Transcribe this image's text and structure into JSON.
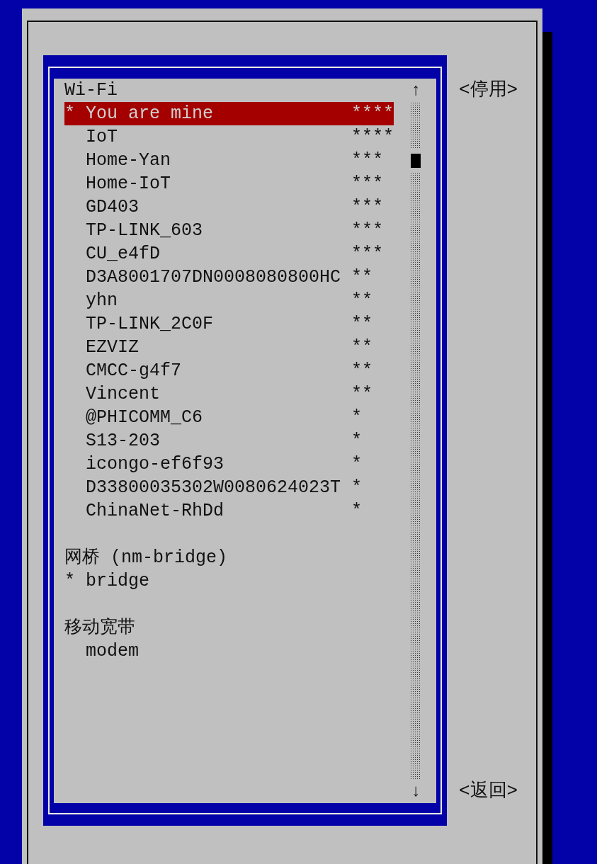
{
  "connection_list": {
    "sections": [
      {
        "heading": "Wi-Fi",
        "items": [
          {
            "marker": "*",
            "name": "You are mine",
            "signal": "****",
            "selected": true
          },
          {
            "name": "IoT",
            "signal": "****",
            "selected": false
          },
          {
            "name": "Home-Yan",
            "signal": "***",
            "selected": false
          },
          {
            "name": "Home-IoT",
            "signal": "***",
            "selected": false
          },
          {
            "name": "GD403",
            "signal": "***",
            "selected": false
          },
          {
            "name": "TP-LINK_603",
            "signal": "***",
            "selected": false
          },
          {
            "name": "CU_e4fD",
            "signal": "***",
            "selected": false
          },
          {
            "name": "D3A8001707DN0008080800HC",
            "signal": "**",
            "selected": false
          },
          {
            "name": "yhn",
            "signal": "**",
            "selected": false
          },
          {
            "name": "TP-LINK_2C0F",
            "signal": "**",
            "selected": false
          },
          {
            "name": "EZVIZ",
            "signal": "**",
            "selected": false
          },
          {
            "name": "CMCC-g4f7",
            "signal": "**",
            "selected": false
          },
          {
            "name": "Vincent",
            "signal": "**",
            "selected": false
          },
          {
            "name": "@PHICOMM_C6",
            "signal": "*",
            "selected": false
          },
          {
            "name": "S13-203",
            "signal": "*",
            "selected": false
          },
          {
            "name": "icongo-ef6f93",
            "signal": "*",
            "selected": false
          },
          {
            "name": "D33800035302W0080624023T",
            "signal": "*",
            "selected": false
          },
          {
            "name": "ChinaNet-RhDd",
            "signal": "*",
            "selected": false
          }
        ]
      },
      {
        "heading": "网桥 (nm-bridge)",
        "items": [
          {
            "marker": "*",
            "name": "bridge",
            "selected": false
          }
        ]
      },
      {
        "heading": "移动宽带",
        "items": [
          {
            "name": "modem",
            "selected": false
          }
        ]
      }
    ],
    "scroll_up": "↑",
    "scroll_down": "↓"
  },
  "buttons": [
    "<停用>",
    "<返回>"
  ]
}
